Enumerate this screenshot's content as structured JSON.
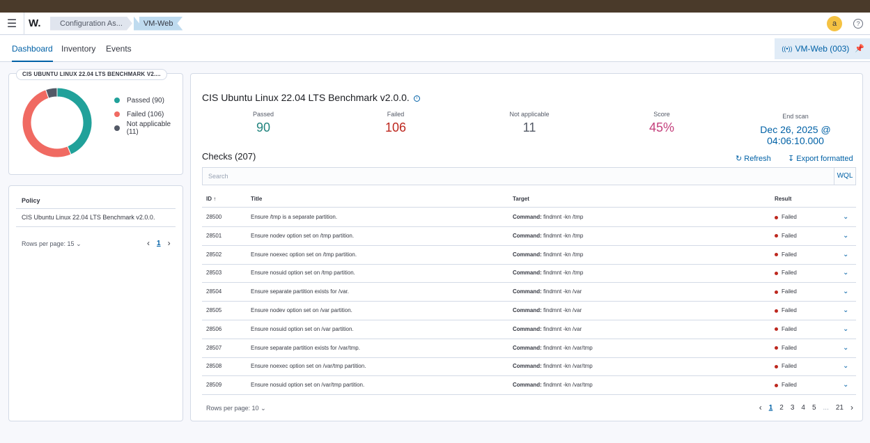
{
  "header": {
    "menu_icon": "hamburger-icon",
    "logo": "W.",
    "breadcrumbs": [
      "Configuration As...",
      "VM-Web"
    ],
    "avatar_initial": "a"
  },
  "tabs": [
    "Dashboard",
    "Inventory",
    "Events"
  ],
  "agent_button": "VM-Web (003)",
  "donut": {
    "title": "CIS UBUNTU LINUX 22.04 LTS BENCHMARK V2....",
    "legend": [
      {
        "label": "Passed (90)",
        "color": "#21a19a",
        "value": 90
      },
      {
        "label": "Failed (106)",
        "color": "#f06a62",
        "value": 106
      },
      {
        "label": "Not applicable (11)",
        "color": "#535966",
        "value": 11
      }
    ]
  },
  "policy_table": {
    "header": "Policy",
    "rows": [
      "CIS Ubuntu Linux 22.04 LTS Benchmark v2.0.0."
    ],
    "rows_per_page": "Rows per page: 15",
    "page": "1"
  },
  "benchmark": {
    "title": "CIS Ubuntu Linux 22.04 LTS Benchmark v2.0.0.",
    "stats": [
      {
        "label": "Passed",
        "value": "90",
        "color": "#21847e"
      },
      {
        "label": "Failed",
        "value": "106",
        "color": "#bd271e"
      },
      {
        "label": "Not applicable",
        "value": "11",
        "color": "#535966"
      },
      {
        "label": "Score",
        "value": "45%",
        "color": "#c4407c"
      },
      {
        "label": "End scan",
        "value": "Dec 26, 2025 @ 04:06:10.000",
        "color": "#0061a6"
      }
    ]
  },
  "checks": {
    "title": "Checks (207)",
    "refresh_label": "Refresh",
    "export_label": "Export formatted",
    "search_placeholder": "Search",
    "wql_label": "WQL",
    "columns": {
      "id": "ID",
      "title": "Title",
      "target": "Target",
      "result": "Result"
    },
    "target_prefix": "Command:",
    "rows": [
      {
        "id": "28500",
        "title": "Ensure /tmp is a separate partition.",
        "target": "findmnt -kn /tmp",
        "result": "Failed"
      },
      {
        "id": "28501",
        "title": "Ensure nodev option set on /tmp partition.",
        "target": "findmnt -kn /tmp",
        "result": "Failed"
      },
      {
        "id": "28502",
        "title": "Ensure noexec option set on /tmp partition.",
        "target": "findmnt -kn /tmp",
        "result": "Failed"
      },
      {
        "id": "28503",
        "title": "Ensure nosuid option set on /tmp partition.",
        "target": "findmnt -kn /tmp",
        "result": "Failed"
      },
      {
        "id": "28504",
        "title": "Ensure separate partition exists for /var.",
        "target": "findmnt -kn /var",
        "result": "Failed"
      },
      {
        "id": "28505",
        "title": "Ensure nodev option set on /var partition.",
        "target": "findmnt -kn /var",
        "result": "Failed"
      },
      {
        "id": "28506",
        "title": "Ensure nosuid option set on /var partition.",
        "target": "findmnt -kn /var",
        "result": "Failed"
      },
      {
        "id": "28507",
        "title": "Ensure separate partition exists for /var/tmp.",
        "target": "findmnt -kn /var/tmp",
        "result": "Failed"
      },
      {
        "id": "28508",
        "title": "Ensure noexec option set on /var/tmp partition.",
        "target": "findmnt -kn /var/tmp",
        "result": "Failed"
      },
      {
        "id": "28509",
        "title": "Ensure nosuid option set on /var/tmp partition.",
        "target": "findmnt -kn /var/tmp",
        "result": "Failed"
      }
    ],
    "rows_per_page": "Rows per page: 10",
    "pages": [
      "1",
      "2",
      "3",
      "4",
      "5",
      "...",
      "21"
    ]
  }
}
